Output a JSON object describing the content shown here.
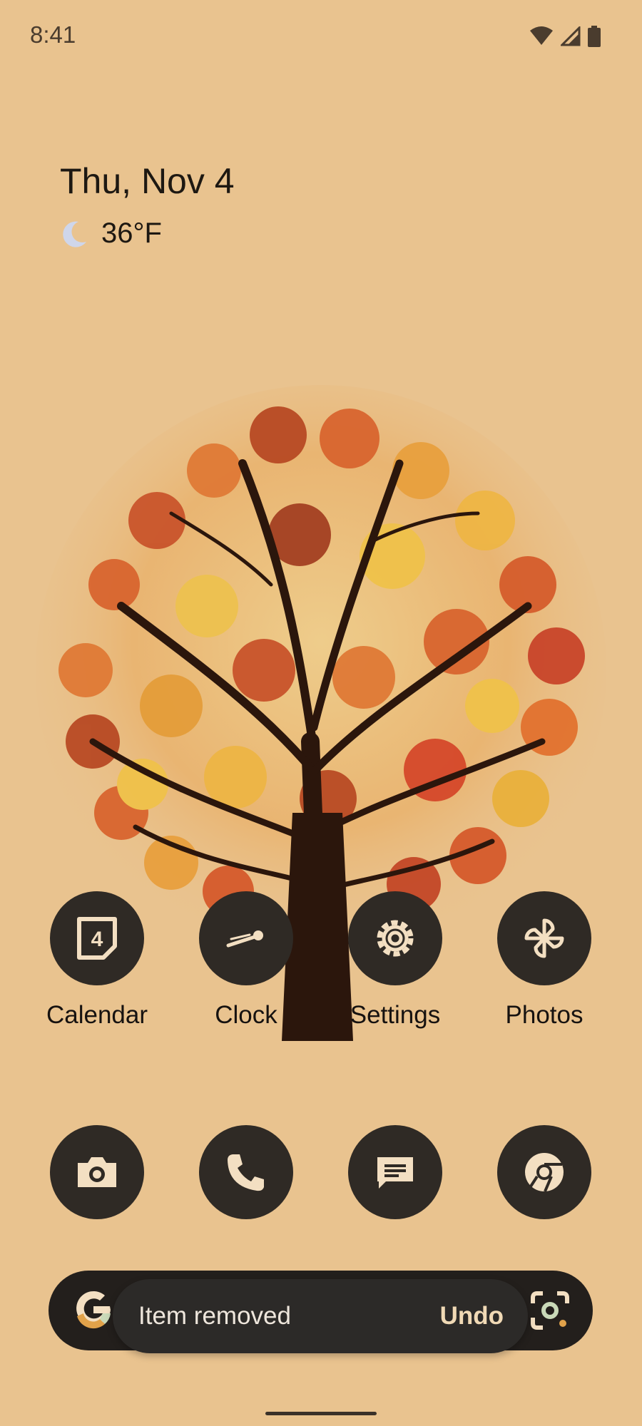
{
  "status_bar": {
    "time": "8:41"
  },
  "glance": {
    "date": "Thu, Nov 4",
    "temperature": "36°F",
    "weather_icon": "moon-icon"
  },
  "apps": [
    {
      "label": "Calendar",
      "icon": "calendar-icon",
      "badge": "4"
    },
    {
      "label": "Clock",
      "icon": "clock-icon"
    },
    {
      "label": "Settings",
      "icon": "gear-icon"
    },
    {
      "label": "Photos",
      "icon": "pinwheel-icon"
    }
  ],
  "dock": [
    {
      "icon": "camera-icon"
    },
    {
      "icon": "phone-icon"
    },
    {
      "icon": "messages-icon"
    },
    {
      "icon": "chrome-icon"
    }
  ],
  "search_bar": {
    "left_icon": "google-g-icon",
    "right_icon": "lens-icon"
  },
  "snackbar": {
    "message": "Item removed",
    "action": "Undo"
  },
  "colors": {
    "background": "#e9c38f",
    "icon_bg": "#2f2a25",
    "icon_fg": "#f3dfc2"
  }
}
